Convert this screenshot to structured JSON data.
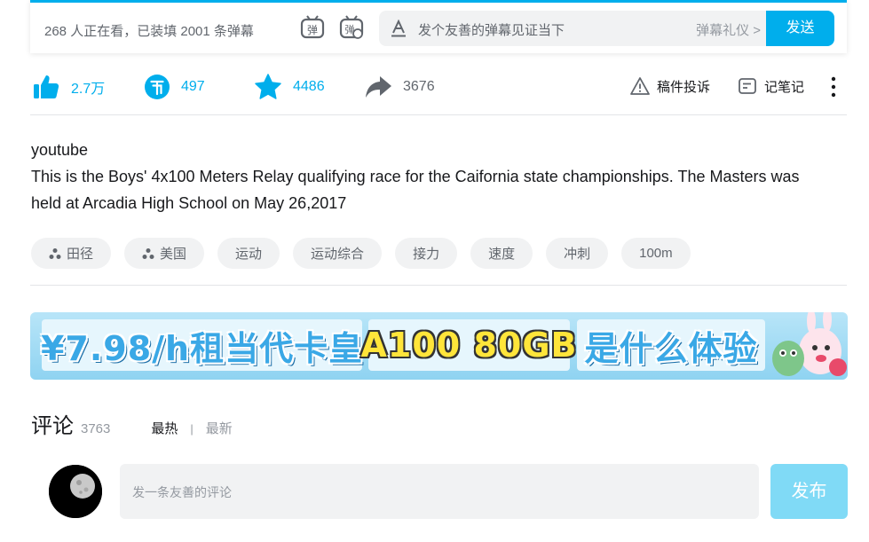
{
  "danmaku_bar": {
    "viewing_text": "268 人正在看，已装填 2001 条弹幕",
    "toggle_danmaku_icon": "danmaku-toggle-icon",
    "danmaku_settings_icon": "danmaku-settings-icon",
    "input_placeholder": "发个友善的弹幕见证当下",
    "etiquette_label": "弹幕礼仪 >",
    "send_label": "发送"
  },
  "toolbar": {
    "like_count": "2.7万",
    "coin_count": "497",
    "favorite_count": "4486",
    "share_count": "3676",
    "report_label": "稿件投诉",
    "notes_label": "记笔记",
    "icons": [
      "thumb-up-icon",
      "coin-icon",
      "star-icon",
      "share-icon",
      "warning-icon",
      "note-icon",
      "more-icon"
    ]
  },
  "description": {
    "line1": "youtube",
    "line2": "This is the Boys' 4x100 Meters Relay qualifying race for the Caifornia state championships. The Masters was held at Arcadia High School on May 26,2017"
  },
  "tags": [
    {
      "label": "田径",
      "icon": "channel-icon"
    },
    {
      "label": "美国",
      "icon": "channel-icon"
    },
    {
      "label": "运动"
    },
    {
      "label": "运动综合"
    },
    {
      "label": "接力"
    },
    {
      "label": "速度"
    },
    {
      "label": "冲刺"
    },
    {
      "label": "100m"
    }
  ],
  "banner": {
    "seg1": "¥7.98/h租当代卡皇",
    "seg2": "A100 80GB",
    "seg3": "是什么体验"
  },
  "comments": {
    "title": "评论",
    "count": "3763",
    "sort_hot": "最热",
    "sort_sep": "|",
    "sort_new": "最新",
    "input_placeholder": "发一条友善的评论",
    "post_label": "发布"
  },
  "colors": {
    "accent": "#00aeec",
    "text_secondary": "#61666d",
    "background_light": "#f1f2f3"
  }
}
